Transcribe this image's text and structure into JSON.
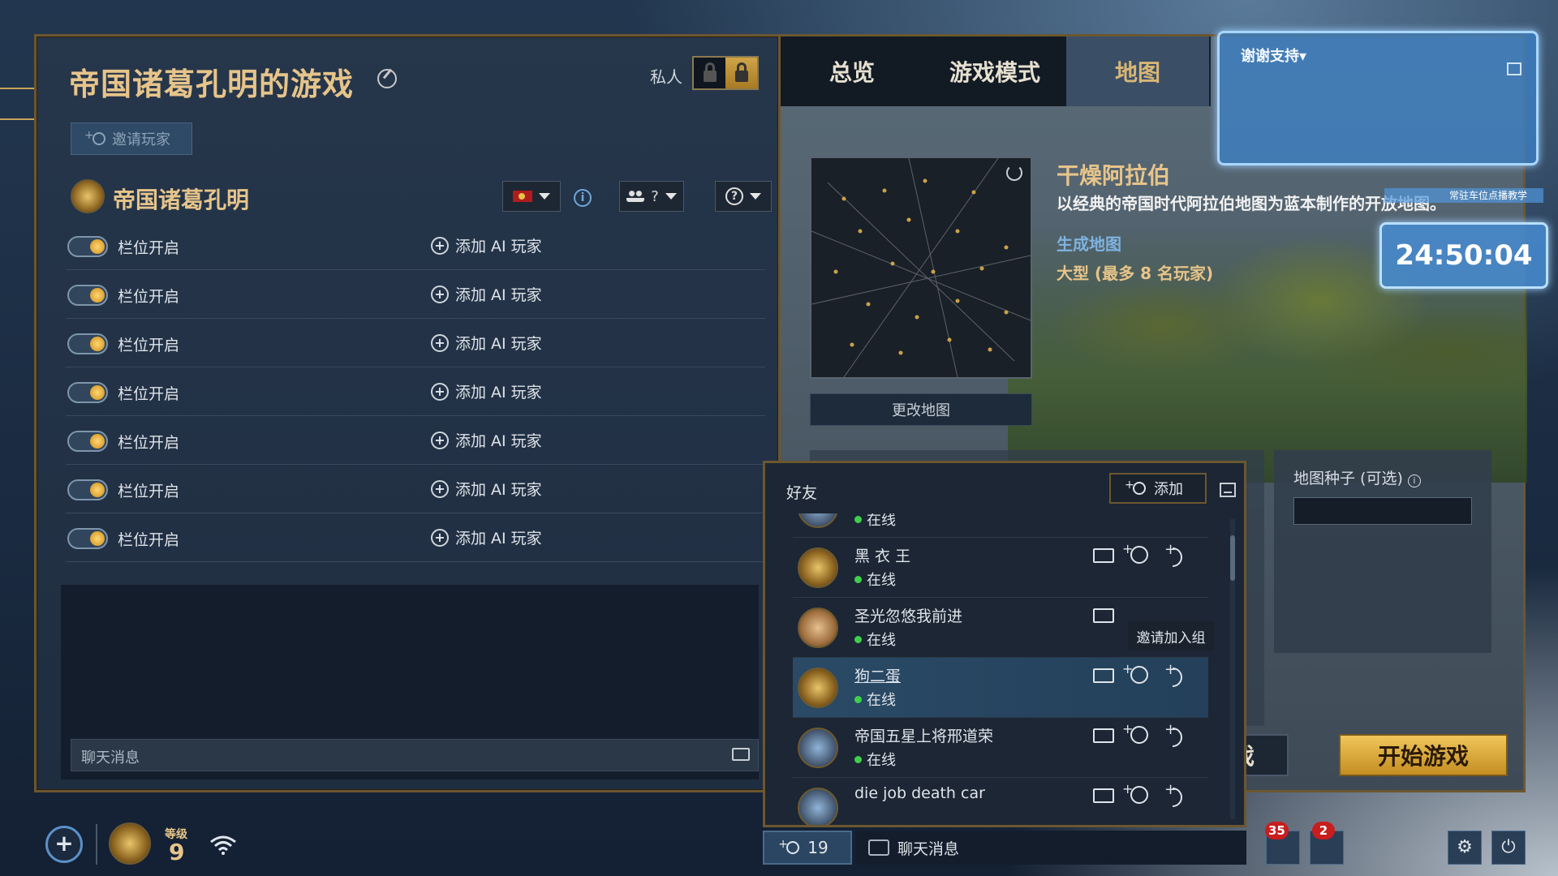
{
  "lobby": {
    "title": "帝国诸葛孔明的游戏",
    "private_label": "私人",
    "invite_label": "邀请玩家",
    "host_name": "帝国诸葛孔明",
    "team_dropdown": "?",
    "slots": [
      {
        "label": "栏位开启",
        "add_ai": "添加 AI 玩家"
      },
      {
        "label": "栏位开启",
        "add_ai": "添加 AI 玩家"
      },
      {
        "label": "栏位开启",
        "add_ai": "添加 AI 玩家"
      },
      {
        "label": "栏位开启",
        "add_ai": "添加 AI 玩家"
      },
      {
        "label": "栏位开启",
        "add_ai": "添加 AI 玩家"
      },
      {
        "label": "栏位开启",
        "add_ai": "添加 AI 玩家"
      },
      {
        "label": "栏位开启",
        "add_ai": "添加 AI 玩家"
      }
    ],
    "chat_placeholder": "聊天消息"
  },
  "tabs": [
    {
      "label": "总览",
      "active": false
    },
    {
      "label": "游戏模式",
      "active": false
    },
    {
      "label": "地图",
      "active": true
    }
  ],
  "map": {
    "name": "干燥阿拉伯",
    "description": "以经典的帝国时代阿拉伯地图为蓝本制作的开放地图。",
    "generate_label": "生成地图",
    "size": "大型 (最多 8 名玩家)",
    "change_map_label": "更改地图",
    "seed_label": "地图种子 (可选)",
    "seed_value": ""
  },
  "buttons": {
    "game_partial": "游戏",
    "start_game": "开始游戏"
  },
  "overlay": {
    "title": "谢谢支持▾",
    "tag": "常驻车位点播教学",
    "timer": "24:50:04"
  },
  "friends": {
    "title": "好友",
    "add_label": "添加",
    "tooltip": "邀请加入组",
    "list": [
      {
        "name": "",
        "status": "在线",
        "avatar": "blue"
      },
      {
        "name": "黑 衣 王",
        "status": "在线",
        "avatar": "gold"
      },
      {
        "name": "圣光忽悠我前进",
        "status": "在线",
        "avatar": "king"
      },
      {
        "name": "狗二蛋",
        "status": "在线",
        "avatar": "gold"
      },
      {
        "name": "帝国五星上将邢道荣",
        "status": "在线",
        "avatar": "blue"
      },
      {
        "name": "die job death car",
        "status": "",
        "avatar": "blue"
      }
    ]
  },
  "bottom": {
    "friend_count": "19",
    "chat_label": "聊天消息",
    "level_label": "等级",
    "level": "9",
    "notif_badge_1": "35",
    "notif_badge_2": "2"
  },
  "colors": {
    "gold_title": "#e6c48a",
    "start_button": "#e0b04a",
    "online": "#3ed04c",
    "link_blue": "#7fb3e0"
  }
}
